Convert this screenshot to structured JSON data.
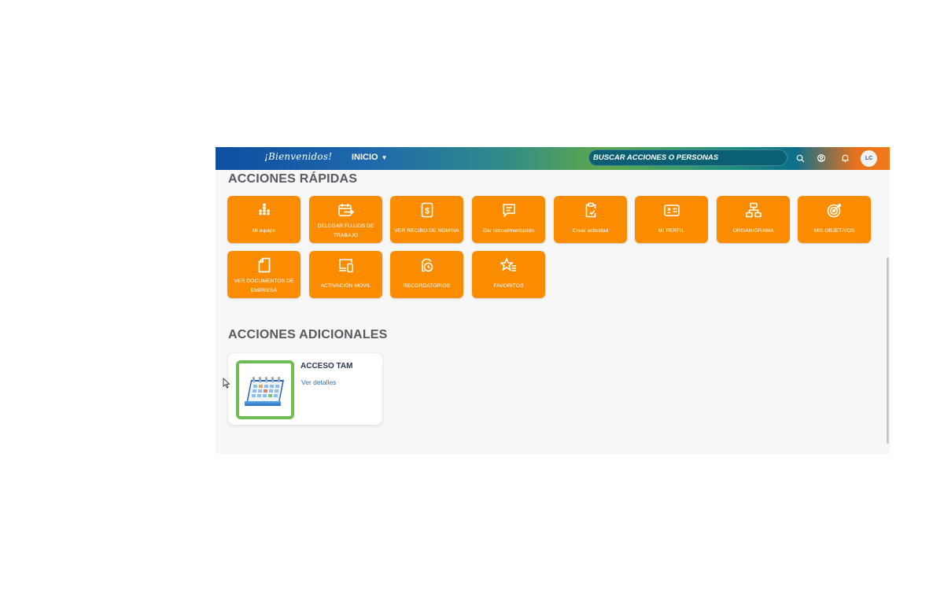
{
  "header": {
    "brand": "¡Bienvenidos!",
    "nav_label": "INICIO",
    "search_placeholder": "BUSCAR ACCIONES O PERSONAS",
    "avatar_initials": "LC"
  },
  "quick_actions": {
    "title": "ACCIONES RÁPIDAS",
    "tiles": [
      {
        "label": "Mi equipo",
        "icon": "team-hierarchy-icon"
      },
      {
        "label": "DELEGAR FLUJOS DE TRABAJO",
        "icon": "calendar-delegate-icon"
      },
      {
        "label": "VER RECIBO DE NÓMINA",
        "icon": "payslip-icon"
      },
      {
        "label": "Dar retroalimentación",
        "icon": "feedback-icon"
      },
      {
        "label": "Crear actividad",
        "icon": "clipboard-check-icon"
      },
      {
        "label": "MI PERFIL",
        "icon": "id-card-icon"
      },
      {
        "label": "ORGANIGRAMA",
        "icon": "org-chart-icon"
      },
      {
        "label": "MIS OBJETIVOS",
        "icon": "target-icon"
      },
      {
        "label": "VER DOCUMENTOS DE EMPRESA",
        "icon": "document-icon"
      },
      {
        "label": "ACTIVACIÓN MÓVIL",
        "icon": "devices-icon"
      },
      {
        "label": "RECORDATORIOS",
        "icon": "reminder-icon"
      },
      {
        "label": "FAVORITOS",
        "icon": "star-list-icon"
      }
    ]
  },
  "additional_actions": {
    "title": "ACCIONES ADICIONALES",
    "card": {
      "title": "ACCESO TAM",
      "link": "Ver detalles",
      "icon": "calendar-icon"
    }
  },
  "colors": {
    "tile_orange": "#fb8c00",
    "card_border_green": "#6dbd53",
    "link_blue": "#2f6fb6"
  }
}
